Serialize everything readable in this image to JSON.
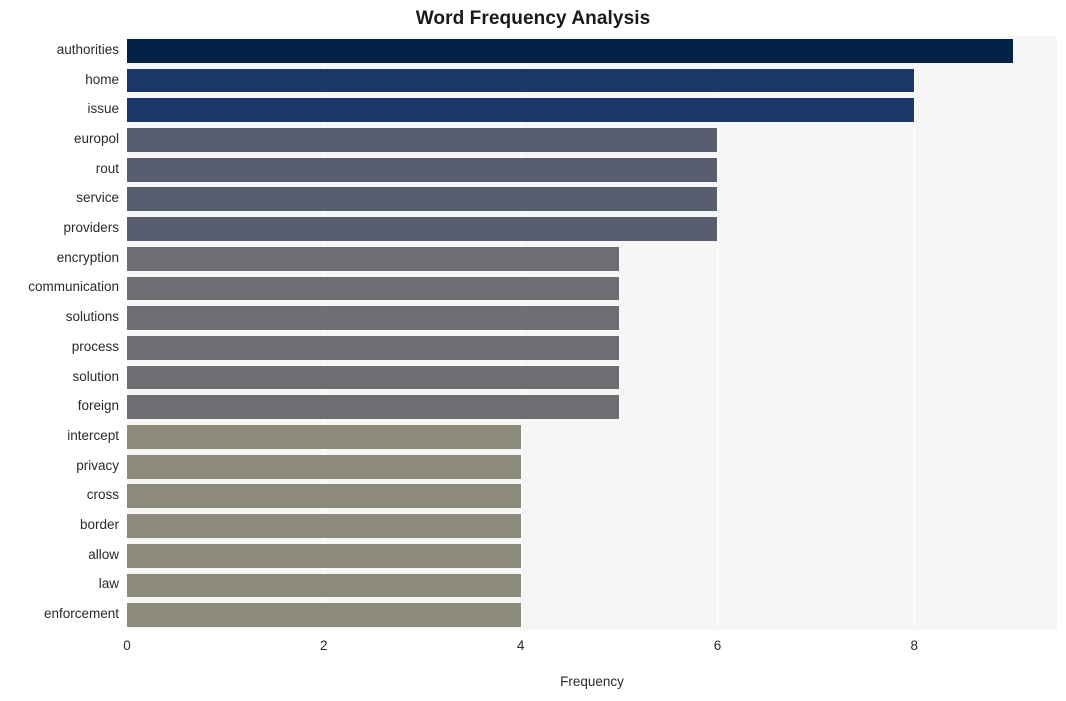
{
  "chart_data": {
    "type": "bar",
    "orientation": "horizontal",
    "title": "Word Frequency Analysis",
    "xlabel": "Frequency",
    "ylabel": "",
    "categories": [
      "authorities",
      "home",
      "issue",
      "europol",
      "rout",
      "service",
      "providers",
      "encryption",
      "communication",
      "solutions",
      "process",
      "solution",
      "foreign",
      "intercept",
      "privacy",
      "cross",
      "border",
      "allow",
      "law",
      "enforcement"
    ],
    "values": [
      9,
      8,
      8,
      6,
      6,
      6,
      6,
      5,
      5,
      5,
      5,
      5,
      5,
      4,
      4,
      4,
      4,
      4,
      4,
      4
    ],
    "bar_colors": [
      "#042147",
      "#1b3668",
      "#1b3668",
      "#595d70",
      "#595d70",
      "#595d70",
      "#595d70",
      "#6e6e72",
      "#6e6e72",
      "#6e6e72",
      "#6e6e72",
      "#6e6e72",
      "#6e6e72",
      "#8c8a7b",
      "#8c8a7b",
      "#8c8a7b",
      "#8c8a7b",
      "#8c8a7b",
      "#8c8a7b",
      "#8c8a7b"
    ],
    "xlim": [
      0,
      9.45
    ],
    "ylim_categories": 20,
    "x_ticks": [
      0,
      2,
      4,
      6,
      8
    ],
    "x_tick_labels": [
      "0",
      "2",
      "4",
      "6",
      "8"
    ],
    "grid": {
      "vertical": true,
      "horizontal": false,
      "color": "#ffffff"
    },
    "legend": {
      "visible": false,
      "position": "none"
    },
    "plot_background": "#f6f6f7",
    "figure_background": "#ffffff",
    "axis_text_color": "#2a2a2a",
    "title_color": "#1a1a1a"
  }
}
